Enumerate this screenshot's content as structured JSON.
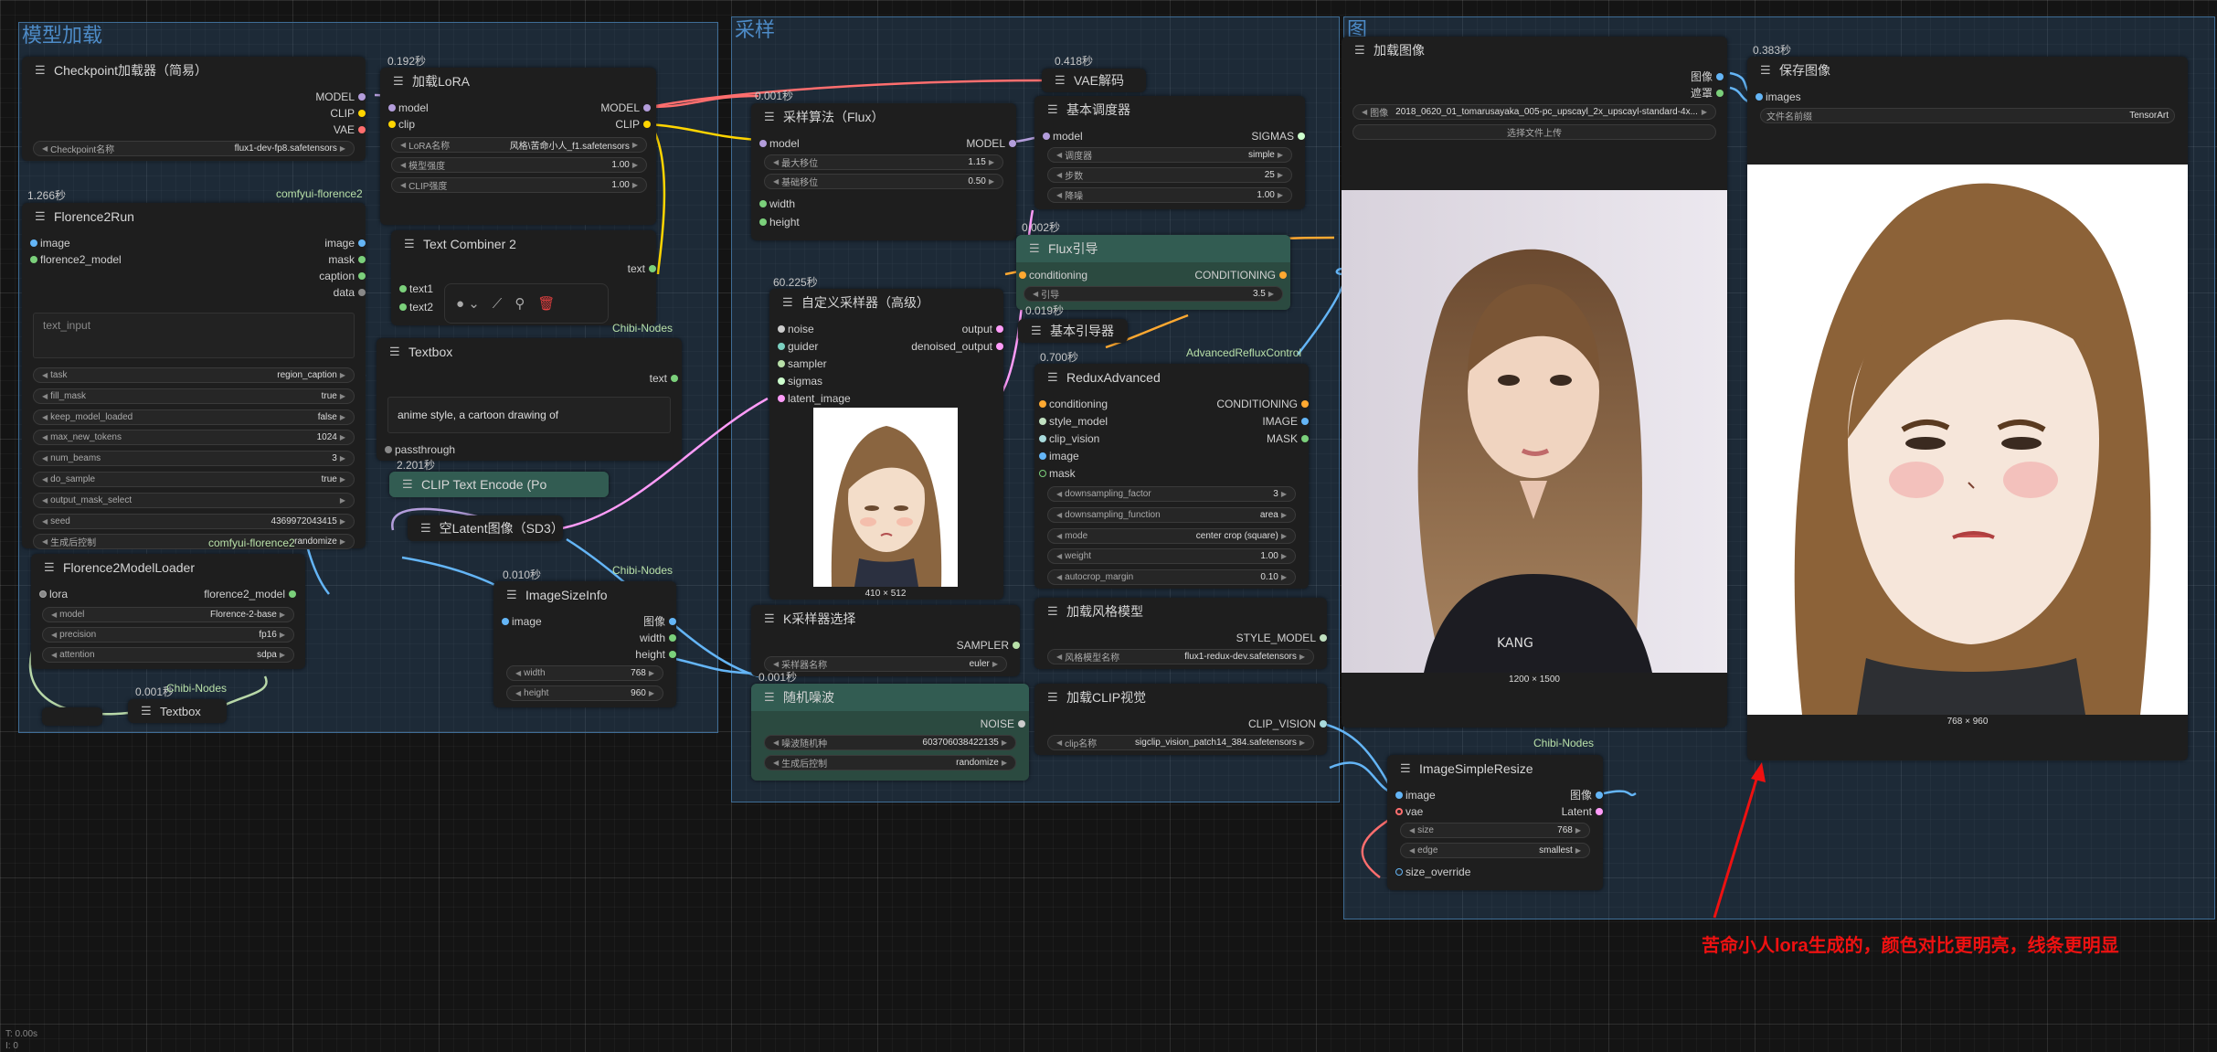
{
  "groups": {
    "model_load": "模型加载",
    "sampling": "采样",
    "image": "图"
  },
  "colors": {
    "model": "#b39ddb",
    "clip": "#ffd500",
    "vae": "#ff6e6e",
    "conditioning": "#ffa931",
    "image": "#64b5f6",
    "latent": "#ff9cf9",
    "green_node": "#2b4a40",
    "group_bg": "#325a82"
  },
  "checkpoint": {
    "title": "Checkpoint加载器（简易）",
    "out_model": "MODEL",
    "out_clip": "CLIP",
    "out_vae": "VAE",
    "widget_label": "Checkpoint名称",
    "widget_value": "flux1-dev-fp8.safetensors"
  },
  "lora": {
    "timer": "0.192秒",
    "title": "加载LoRA",
    "in_model": "model",
    "in_clip": "clip",
    "out_model": "MODEL",
    "out_clip": "CLIP",
    "w_name_label": "LoRA名称",
    "w_name_value": "风格\\苦命小人_f1.safetensors",
    "w_model_label": "模型强度",
    "w_model_value": "1.00",
    "w_clip_label": "CLIP强度",
    "w_clip_value": "1.00"
  },
  "florence_run": {
    "timer": "1.266秒",
    "tag": "comfyui-florence2",
    "title": "Florence2Run",
    "in_image": "image",
    "in_model": "florence2_model",
    "out_image": "image",
    "out_mask": "mask",
    "out_caption": "caption",
    "out_data": "data",
    "placeholder": "text_input",
    "widgets": [
      {
        "label": "task",
        "value": "region_caption"
      },
      {
        "label": "fill_mask",
        "value": "true"
      },
      {
        "label": "keep_model_loaded",
        "value": "false"
      },
      {
        "label": "max_new_tokens",
        "value": "1024"
      },
      {
        "label": "num_beams",
        "value": "3"
      },
      {
        "label": "do_sample",
        "value": "true"
      },
      {
        "label": "output_mask_select",
        "value": ""
      },
      {
        "label": "seed",
        "value": "4369972043415"
      },
      {
        "label": "生成后控制",
        "value": "randomize"
      }
    ]
  },
  "florence_loader": {
    "tag": "comfyui-florence2",
    "title": "Florence2ModelLoader",
    "in_lora": "lora",
    "out_model": "florence2_model",
    "widgets": [
      {
        "label": "model",
        "value": "Florence-2-base"
      },
      {
        "label": "precision",
        "value": "fp16"
      },
      {
        "label": "attention",
        "value": "sdpa"
      }
    ]
  },
  "text_small": {
    "timer": "0.001秒",
    "tag": "Chibi-Nodes",
    "title": "Textbox"
  },
  "text_combiner": {
    "title": "Text Combiner 2",
    "in1": "text1",
    "in2": "text2",
    "out": "text"
  },
  "textbox": {
    "tag": "Chibi-Nodes",
    "title": "Textbox",
    "out": "text",
    "content": "anime style,  a cartoon drawing of",
    "passthrough": "passthrough",
    "timer": "2.201秒"
  },
  "clip_encode": {
    "title": "CLIP Text Encode (Po"
  },
  "empty_latent": {
    "title": "空Latent图像（SD3）"
  },
  "image_size_info": {
    "timer": "0.010秒",
    "tag": "Chibi-Nodes",
    "title": "ImageSizeInfo",
    "in_image": "image",
    "out_image": "图像",
    "out_width": "width",
    "out_height": "height",
    "w_width_label": "width",
    "w_width_value": "768",
    "w_height_label": "height",
    "w_height_value": "960"
  },
  "sampling_algo": {
    "timer": "0.001秒",
    "title": "采样算法（Flux）",
    "in_model": "model",
    "out_model": "MODEL",
    "w1_label": "最大移位",
    "w1_value": "1.15",
    "w2_label": "基础移位",
    "w2_value": "0.50",
    "in_width": "width",
    "in_height": "height"
  },
  "custom_sampler": {
    "timer": "60.225秒",
    "title": "自定义采样器（高级）",
    "in_noise": "noise",
    "in_guider": "guider",
    "in_sampler": "sampler",
    "in_sigmas": "sigmas",
    "in_latent": "latent_image",
    "out_output": "output",
    "out_denoised": "denoised_output",
    "preview_caption": "410 × 512"
  },
  "ksampler_select": {
    "title": "K采样器选择",
    "out": "SAMPLER",
    "w_label": "采样器名称",
    "w_value": "euler"
  },
  "random_noise": {
    "timer": "0.001秒",
    "title": "随机噪波",
    "out": "NOISE",
    "w1_label": "噪波随机种",
    "w1_value": "603706038422135",
    "w2_label": "生成后控制",
    "w2_value": "randomize"
  },
  "vae_decode": {
    "timer": "0.418秒",
    "title": "VAE解码"
  },
  "basic_scheduler": {
    "title": "基本调度器",
    "in_model": "model",
    "out": "SIGMAS",
    "widgets": [
      {
        "label": "调度器",
        "value": "simple"
      },
      {
        "label": "步数",
        "value": "25"
      },
      {
        "label": "降噪",
        "value": "1.00"
      }
    ]
  },
  "flux_guidance": {
    "timer": "0.002秒",
    "title": "Flux引导",
    "in": "conditioning",
    "out": "CONDITIONING",
    "w_label": "引导",
    "w_value": "3.5"
  },
  "basic_guider": {
    "timer": "0.019秒",
    "title": "基本引导器"
  },
  "redux": {
    "timer": "0.700秒",
    "tag": "AdvancedRefluxControl",
    "title": "ReduxAdvanced",
    "in_conditioning": "conditioning",
    "in_style_model": "style_model",
    "in_clip_vision": "clip_vision",
    "in_image": "image",
    "in_mask": "mask",
    "out_conditioning": "CONDITIONING",
    "out_image": "IMAGE",
    "out_mask": "MASK",
    "widgets": [
      {
        "label": "downsampling_factor",
        "value": "3"
      },
      {
        "label": "downsampling_function",
        "value": "area"
      },
      {
        "label": "mode",
        "value": "center crop (square)"
      },
      {
        "label": "weight",
        "value": "1.00"
      },
      {
        "label": "autocrop_margin",
        "value": "0.10"
      }
    ]
  },
  "style_model": {
    "title": "加载风格模型",
    "out": "STYLE_MODEL",
    "w_label": "风格模型名称",
    "w_value": "flux1-redux-dev.safetensors"
  },
  "clip_vision": {
    "title": "加载CLIP视觉",
    "out": "CLIP_VISION",
    "w_label": "clip名称",
    "w_value": "sigclip_vision_patch14_384.safetensors"
  },
  "load_image": {
    "title": "加载图像",
    "out_image": "图像",
    "out_mask": "遮罩",
    "w_label": "图像",
    "w_value": "2018_0620_01_tomarusayaka_005-pc_upscayl_2x_upscayl-standard-4x...",
    "upload": "选择文件上传",
    "caption": "1200 × 1500"
  },
  "save_image": {
    "timer": "0.383秒",
    "title": "保存图像",
    "in_images": "images",
    "w_label": "文件名前缀",
    "w_value": "TensorArt",
    "caption": "768 × 960"
  },
  "image_resize": {
    "tag": "Chibi-Nodes",
    "title": "ImageSimpleResize",
    "in_image": "image",
    "in_vae": "vae",
    "out_image": "图像",
    "out_latent": "Latent",
    "w1_label": "size",
    "w1_value": "768",
    "w2_label": "edge",
    "w2_value": "smallest",
    "in_size": "size_override"
  },
  "annotation": "苦命小人lora生成的，颜色对比更明亮，线条更明显",
  "status": {
    "time": "T: 0.00s",
    "line2": "I: 0"
  }
}
